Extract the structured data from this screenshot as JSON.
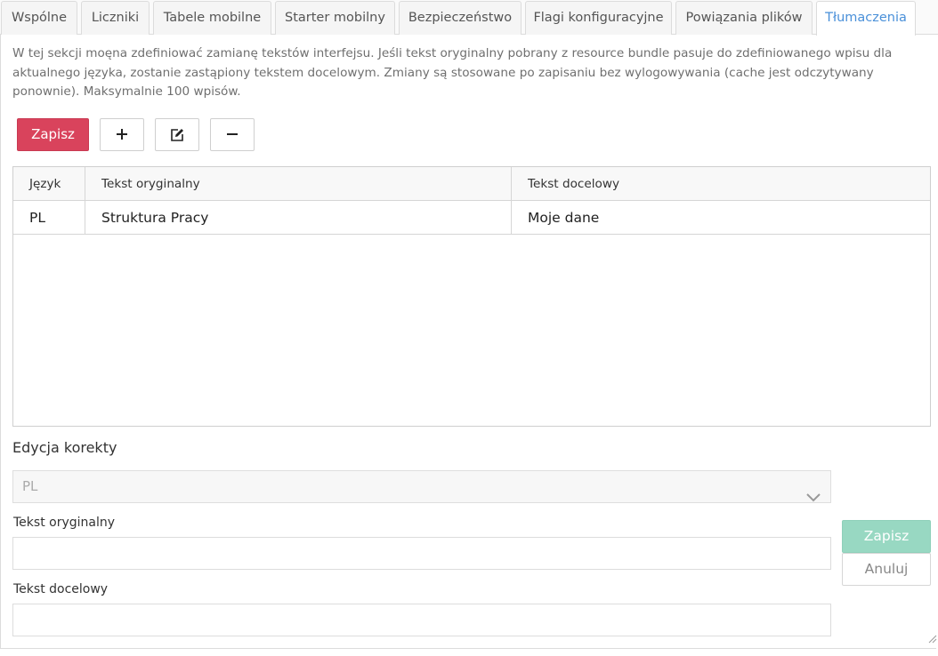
{
  "tabs": [
    {
      "label": "Wspólne"
    },
    {
      "label": "Liczniki"
    },
    {
      "label": "Tabele mobilne"
    },
    {
      "label": "Starter mobilny"
    },
    {
      "label": "Bezpieczeństwo"
    },
    {
      "label": "Flagi konfiguracyjne"
    },
    {
      "label": "Powiązania plików"
    },
    {
      "label": "Tłumaczenia",
      "active": true
    }
  ],
  "description": "W tej sekcji moęna zdefiniować zamianę tekstów interfejsu. Jeśli tekst oryginalny pobrany z resource bundle pasuje do zdefiniowanego wpisu dla aktualnego języka, zostanie zastąpiony tekstem docelowym. Zmiany są stosowane po zapisaniu bez wylogowywania (cache jest odczytywany ponownie). Maksymalnie 100 wpisów.",
  "toolbar": {
    "save_label": "Zapisz",
    "add_icon": "plus-icon",
    "edit_icon": "edit-icon",
    "remove_icon": "minus-icon"
  },
  "table": {
    "columns": [
      "Język",
      "Tekst oryginalny",
      "Tekst docelowy"
    ],
    "rows": [
      {
        "lang": "PL",
        "original": "Struktura Pracy",
        "target": "Moje dane"
      }
    ]
  },
  "editor": {
    "title": "Edycja korekty",
    "language_value": "PL",
    "original_label": "Tekst oryginalny",
    "original_value": "",
    "target_label": "Tekst docelowy",
    "target_value": "",
    "save_label": "Zapisz",
    "cancel_label": "Anuluj"
  },
  "colors": {
    "accent": "#4a90d9",
    "save_button": "#d9435c",
    "save_disabled": "#98d8c2"
  }
}
